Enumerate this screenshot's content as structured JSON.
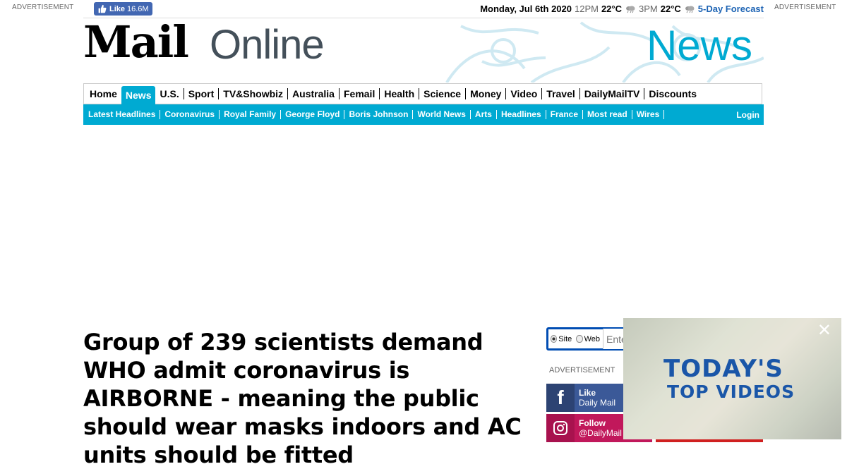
{
  "ads": {
    "left_label": "ADVERTISEMENT",
    "right_label": "ADVERTISEMENT",
    "sidebar_label": "ADVERTISEMENT"
  },
  "facebook_like": {
    "label": "Like",
    "count": "16.6M"
  },
  "weather": {
    "date": "Monday, Jul 6th 2020",
    "time1": "12PM",
    "temp1": "22°C",
    "time2": "3PM",
    "temp2": "22°C",
    "forecast_link": "5-Day Forecast"
  },
  "masthead": {
    "logo_mail": "Mail",
    "logo_online": "Online",
    "section_title": "News"
  },
  "nav_primary": [
    {
      "label": "Home",
      "active": false
    },
    {
      "label": "News",
      "active": true
    },
    {
      "label": "U.S.",
      "active": false
    },
    {
      "label": "Sport",
      "active": false
    },
    {
      "label": "TV&Showbiz",
      "active": false
    },
    {
      "label": "Australia",
      "active": false
    },
    {
      "label": "Femail",
      "active": false
    },
    {
      "label": "Health",
      "active": false
    },
    {
      "label": "Science",
      "active": false
    },
    {
      "label": "Money",
      "active": false
    },
    {
      "label": "Video",
      "active": false
    },
    {
      "label": "Travel",
      "active": false
    },
    {
      "label": "DailyMailTV",
      "active": false
    },
    {
      "label": "Discounts",
      "active": false
    }
  ],
  "nav_secondary": [
    "Latest Headlines",
    "Coronavirus",
    "Royal Family",
    "George Floyd",
    "Boris Johnson",
    "World News",
    "Arts",
    "Headlines",
    "France",
    "Most read",
    "Wires"
  ],
  "nav_login": "Login",
  "article": {
    "headline": "Group of 239 scientists demand WHO admit coronavirus is AIRBORNE - meaning the public should wear masks indoors and AC units should be fitted"
  },
  "search": {
    "option_site": "Site",
    "option_web": "Web",
    "selected": "Site",
    "placeholder": "Enter your search"
  },
  "social": {
    "facebook_action": "Like",
    "facebook_name": "Daily Mail",
    "instagram_action": "Follow",
    "instagram_handle": "@DailyMail"
  },
  "video_popup": {
    "line1": "TODAY'S",
    "line2": "TOP VIDEOS",
    "close": "✕"
  },
  "colors": {
    "accent": "#00aad2",
    "facebook": "#3b5998",
    "instagram": "#c1185b",
    "search_border": "#004db3",
    "forecast_link": "#1e64b4"
  }
}
